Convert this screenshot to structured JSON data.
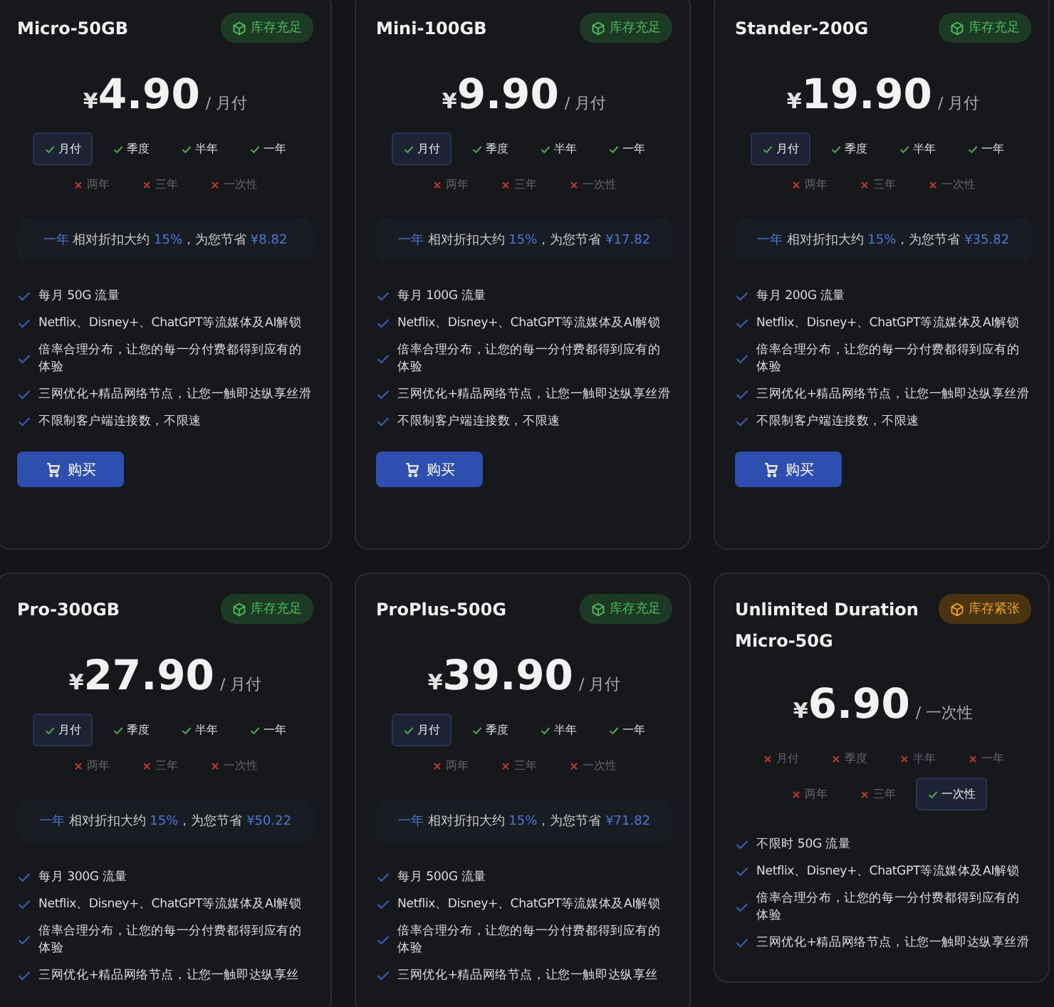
{
  "plans": [
    {
      "name": "Micro-50GB",
      "stock": {
        "kind": "ok",
        "label": "库存充足"
      },
      "currency": "¥",
      "price": "4.90",
      "unit": "/ 月付",
      "periods": [
        {
          "label": "月付",
          "available": true,
          "selected": true
        },
        {
          "label": "季度",
          "available": true,
          "selected": false
        },
        {
          "label": "半年",
          "available": true,
          "selected": false
        },
        {
          "label": "一年",
          "available": true,
          "selected": false
        },
        {
          "label": "两年",
          "available": false,
          "selected": false
        },
        {
          "label": "三年",
          "available": false,
          "selected": false
        },
        {
          "label": "一次性",
          "available": false,
          "selected": false
        }
      ],
      "savings": {
        "period": "一年",
        "text": "相对折扣大约",
        "percent": "15%",
        "text2": "，为您节省",
        "amount": "¥8.82"
      },
      "features": [
        "每月 50G 流量",
        "Netflix、Disney+、ChatGPT等流媒体及AI解锁",
        "倍率合理分布，让您的每一分付费都得到应有的体验",
        "三网优化+精品网络节点，让您一触即达纵享丝滑",
        "不限制客户端连接数，不限速"
      ],
      "button": "购买"
    },
    {
      "name": "Mini-100GB",
      "stock": {
        "kind": "ok",
        "label": "库存充足"
      },
      "currency": "¥",
      "price": "9.90",
      "unit": "/ 月付",
      "periods": [
        {
          "label": "月付",
          "available": true,
          "selected": true
        },
        {
          "label": "季度",
          "available": true,
          "selected": false
        },
        {
          "label": "半年",
          "available": true,
          "selected": false
        },
        {
          "label": "一年",
          "available": true,
          "selected": false
        },
        {
          "label": "两年",
          "available": false,
          "selected": false
        },
        {
          "label": "三年",
          "available": false,
          "selected": false
        },
        {
          "label": "一次性",
          "available": false,
          "selected": false
        }
      ],
      "savings": {
        "period": "一年",
        "text": "相对折扣大约",
        "percent": "15%",
        "text2": "，为您节省",
        "amount": "¥17.82"
      },
      "features": [
        "每月 100G 流量",
        "Netflix、Disney+、ChatGPT等流媒体及AI解锁",
        "倍率合理分布，让您的每一分付费都得到应有的体验",
        "三网优化+精品网络节点，让您一触即达纵享丝滑",
        "不限制客户端连接数，不限速"
      ],
      "button": "购买"
    },
    {
      "name": "Stander-200G",
      "stock": {
        "kind": "ok",
        "label": "库存充足"
      },
      "currency": "¥",
      "price": "19.90",
      "unit": "/ 月付",
      "periods": [
        {
          "label": "月付",
          "available": true,
          "selected": true
        },
        {
          "label": "季度",
          "available": true,
          "selected": false
        },
        {
          "label": "半年",
          "available": true,
          "selected": false
        },
        {
          "label": "一年",
          "available": true,
          "selected": false
        },
        {
          "label": "两年",
          "available": false,
          "selected": false
        },
        {
          "label": "三年",
          "available": false,
          "selected": false
        },
        {
          "label": "一次性",
          "available": false,
          "selected": false
        }
      ],
      "savings": {
        "period": "一年",
        "text": "相对折扣大约",
        "percent": "15%",
        "text2": "，为您节省",
        "amount": "¥35.82"
      },
      "features": [
        "每月 200G 流量",
        "Netflix、Disney+、ChatGPT等流媒体及AI解锁",
        "倍率合理分布，让您的每一分付费都得到应有的体验",
        "三网优化+精品网络节点，让您一触即达纵享丝滑",
        "不限制客户端连接数，不限速"
      ],
      "button": "购买"
    },
    {
      "name": "Pro-300GB",
      "stock": {
        "kind": "ok",
        "label": "库存充足"
      },
      "currency": "¥",
      "price": "27.90",
      "unit": "/ 月付",
      "periods": [
        {
          "label": "月付",
          "available": true,
          "selected": true
        },
        {
          "label": "季度",
          "available": true,
          "selected": false
        },
        {
          "label": "半年",
          "available": true,
          "selected": false
        },
        {
          "label": "一年",
          "available": true,
          "selected": false
        },
        {
          "label": "两年",
          "available": false,
          "selected": false
        },
        {
          "label": "三年",
          "available": false,
          "selected": false
        },
        {
          "label": "一次性",
          "available": false,
          "selected": false
        }
      ],
      "savings": {
        "period": "一年",
        "text": "相对折扣大约",
        "percent": "15%",
        "text2": "，为您节省",
        "amount": "¥50.22"
      },
      "features": [
        "每月 300G 流量",
        "Netflix、Disney+、ChatGPT等流媒体及AI解锁",
        "倍率合理分布，让您的每一分付费都得到应有的体验",
        "三网优化+精品网络节点，让您一触即达纵享丝"
      ]
    },
    {
      "name": "ProPlus-500G",
      "stock": {
        "kind": "ok",
        "label": "库存充足"
      },
      "currency": "¥",
      "price": "39.90",
      "unit": "/ 月付",
      "periods": [
        {
          "label": "月付",
          "available": true,
          "selected": true
        },
        {
          "label": "季度",
          "available": true,
          "selected": false
        },
        {
          "label": "半年",
          "available": true,
          "selected": false
        },
        {
          "label": "一年",
          "available": true,
          "selected": false
        },
        {
          "label": "两年",
          "available": false,
          "selected": false
        },
        {
          "label": "三年",
          "available": false,
          "selected": false
        },
        {
          "label": "一次性",
          "available": false,
          "selected": false
        }
      ],
      "savings": {
        "period": "一年",
        "text": "相对折扣大约",
        "percent": "15%",
        "text2": "，为您节省",
        "amount": "¥71.82"
      },
      "features": [
        "每月 500G 流量",
        "Netflix、Disney+、ChatGPT等流媒体及AI解锁",
        "倍率合理分布，让您的每一分付费都得到应有的体验",
        "三网优化+精品网络节点，让您一触即达纵享丝"
      ]
    },
    {
      "name": "Unlimited Duration Micro-50G",
      "stock": {
        "kind": "low",
        "label": "库存紧张"
      },
      "currency": "¥",
      "price": "6.90",
      "unit": "/ 一次性",
      "periods": [
        {
          "label": "月付",
          "available": false,
          "selected": false
        },
        {
          "label": "季度",
          "available": false,
          "selected": false
        },
        {
          "label": "半年",
          "available": false,
          "selected": false
        },
        {
          "label": "一年",
          "available": false,
          "selected": false
        },
        {
          "label": "两年",
          "available": false,
          "selected": false
        },
        {
          "label": "三年",
          "available": false,
          "selected": false
        },
        {
          "label": "一次性",
          "available": true,
          "selected": true
        }
      ],
      "features": [
        "不限时 50G 流量",
        "Netflix、Disney+、ChatGPT等流媒体及AI解锁",
        "倍率合理分布，让您的每一分付费都得到应有的体验",
        "三网优化+精品网络节点，让您一触即达纵享丝滑"
      ]
    }
  ]
}
